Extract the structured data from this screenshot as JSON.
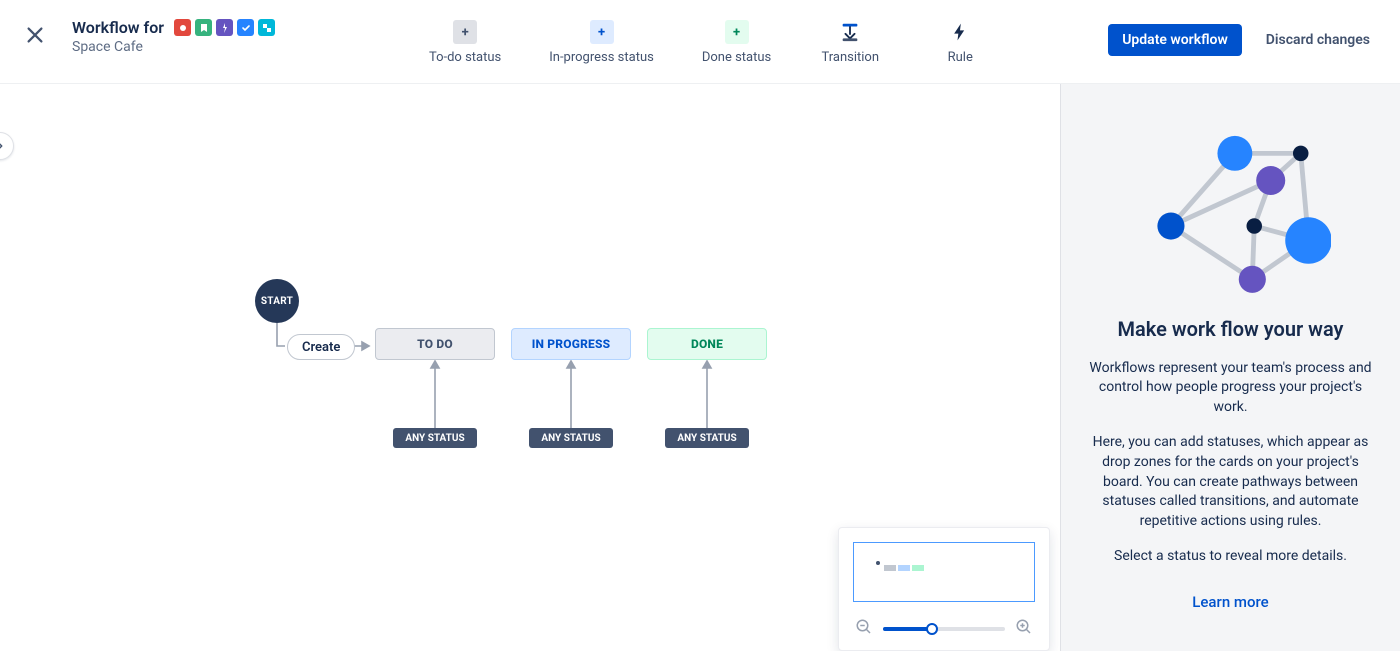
{
  "header": {
    "title_prefix": "Workflow for",
    "project": "Space Cafe",
    "issue_types": [
      {
        "name": "bug",
        "bg": "#E2483D",
        "glyph": "dot"
      },
      {
        "name": "story",
        "bg": "#36B37E",
        "glyph": "bookmark"
      },
      {
        "name": "epic",
        "bg": "#6554C0",
        "glyph": "bolt"
      },
      {
        "name": "task",
        "bg": "#2684FF",
        "glyph": "check"
      },
      {
        "name": "subtask",
        "bg": "#00B8D9",
        "glyph": "branch"
      }
    ]
  },
  "toolbar": {
    "todo": "To-do status",
    "inprogress": "In-progress status",
    "done": "Done status",
    "transition": "Transition",
    "rule": "Rule"
  },
  "actions": {
    "update": "Update workflow",
    "discard": "Discard changes"
  },
  "workflow": {
    "start": "START",
    "create": "Create",
    "nodes": {
      "todo": "TO DO",
      "inprog": "IN PROGRESS",
      "done": "DONE"
    },
    "any_status": "ANY STATUS"
  },
  "side_panel": {
    "title": "Make work flow your way",
    "p1": "Workflows represent your team's process and control how people progress your project's work.",
    "p2": "Here, you can add statuses, which appear as drop zones for the cards on your project's board. You can create pathways between statuses called transitions, and automate repetitive actions using rules.",
    "p3": "Select a status to reveal more details.",
    "learn_more": "Learn more"
  }
}
